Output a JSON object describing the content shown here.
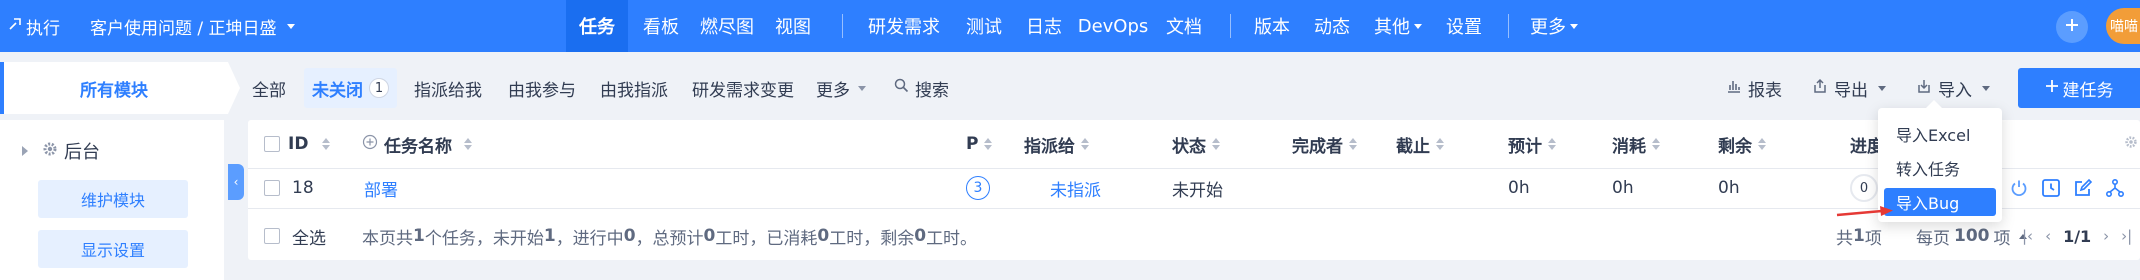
{
  "topbar": {
    "exec_label": "执行",
    "product_label": "客户使用问题 / 正坤日盛",
    "nav": [
      {
        "label": "任务",
        "active": true
      },
      {
        "label": "看板"
      },
      {
        "label": "燃尽图"
      },
      {
        "label": "视图"
      },
      {
        "label": "研发需求"
      },
      {
        "label": "测试"
      },
      {
        "label": "日志"
      },
      {
        "label": "DevOps"
      },
      {
        "label": "文档"
      },
      {
        "label": "版本"
      },
      {
        "label": "动态"
      },
      {
        "label": "其他"
      },
      {
        "label": "设置"
      },
      {
        "label": "更多"
      }
    ],
    "user_label": "喵喵"
  },
  "sidebar": {
    "title": "所有模块",
    "tree_root": "后台",
    "maintain_button": "维护模块",
    "display_button": "显示设置"
  },
  "filters": {
    "all": "全部",
    "unclosed": "未关闭",
    "unclosed_count": "1",
    "assigned_to_me": "指派给我",
    "involved": "由我参与",
    "assigned_by_me": "由我指派",
    "story_change": "研发需求变更",
    "more": "更多",
    "search": "搜索"
  },
  "toolbar": {
    "report": "报表",
    "export": "导出",
    "import": "导入",
    "create_task": "建任务"
  },
  "table": {
    "columns": {
      "id": "ID",
      "name": "任务名称",
      "pri": "P",
      "assigned_to": "指派给",
      "status": "状态",
      "finished_by": "完成者",
      "deadline": "截止",
      "estimate": "预计",
      "consumed": "消耗",
      "left": "剩余",
      "progress": "进度"
    },
    "rows": [
      {
        "id": "18",
        "name": "部署",
        "pri": "3",
        "assigned_to": "未指派",
        "status": "未开始",
        "finished_by": "",
        "deadline": "",
        "estimate": "0h",
        "consumed": "0h",
        "left": "0h",
        "progress": "0"
      }
    ]
  },
  "footer": {
    "select_all": "全选",
    "summary_parts": [
      "本页共 ",
      "1",
      " 个任务，未开始 ",
      "1",
      "，进行中 ",
      "0",
      "，总预计 ",
      "0",
      " 工时，已消耗 ",
      "0",
      " 工时，剩余 ",
      "0",
      " 工时。"
    ],
    "total_prefix": "共 ",
    "total_count": "1",
    "total_suffix": " 项",
    "per_page_prefix": "每页 ",
    "per_page": "100",
    "per_page_suffix": " 项",
    "page": "1/1"
  },
  "import_menu": {
    "items": [
      "导入Excel",
      "转入任务",
      "导入Bug"
    ],
    "highlighted": "导入Bug"
  },
  "colors": {
    "primary": "#2e7fff",
    "annotation_arrow": "#e53935"
  }
}
